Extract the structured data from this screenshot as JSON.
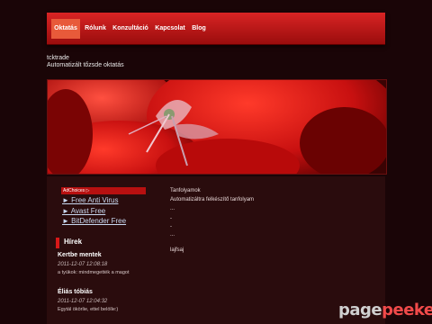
{
  "nav": {
    "items": [
      {
        "label": "Oktatás",
        "active": true
      },
      {
        "label": "Rólunk",
        "active": false
      },
      {
        "label": "Konzultáció",
        "active": false
      },
      {
        "label": "Kapcsolat",
        "active": false
      },
      {
        "label": "Blog",
        "active": false
      }
    ]
  },
  "site": {
    "title": "tcktrade",
    "subtitle": "Automatizált tőzsde oktatás"
  },
  "sidebar": {
    "adchoices": "AdChoices ▷",
    "ads": [
      "► Free Anti Virus",
      "► Avast Free",
      "► BitDefender Free"
    ],
    "news_heading": "Hírek",
    "news": [
      {
        "title": "Kertbe mentek",
        "date": "2011-12-07 12:08:18",
        "text": "a tyúkok: mindmegették a magot"
      },
      {
        "title": "Éliás tóbiás",
        "date": "2011-12-07 12:04:32",
        "text": "Egytál ökörlie, ettel belölle:)"
      }
    ]
  },
  "main": {
    "lines": [
      "Tanfolyamok",
      "Automatizáltra felkészítő tanfolyam",
      "...",
      "-",
      "-",
      "...",
      "lajfsaj"
    ]
  },
  "watermark": {
    "part1": "page",
    "part2": "peeker"
  },
  "colors": {
    "accent": "#d81818",
    "background": "#1a0507"
  }
}
